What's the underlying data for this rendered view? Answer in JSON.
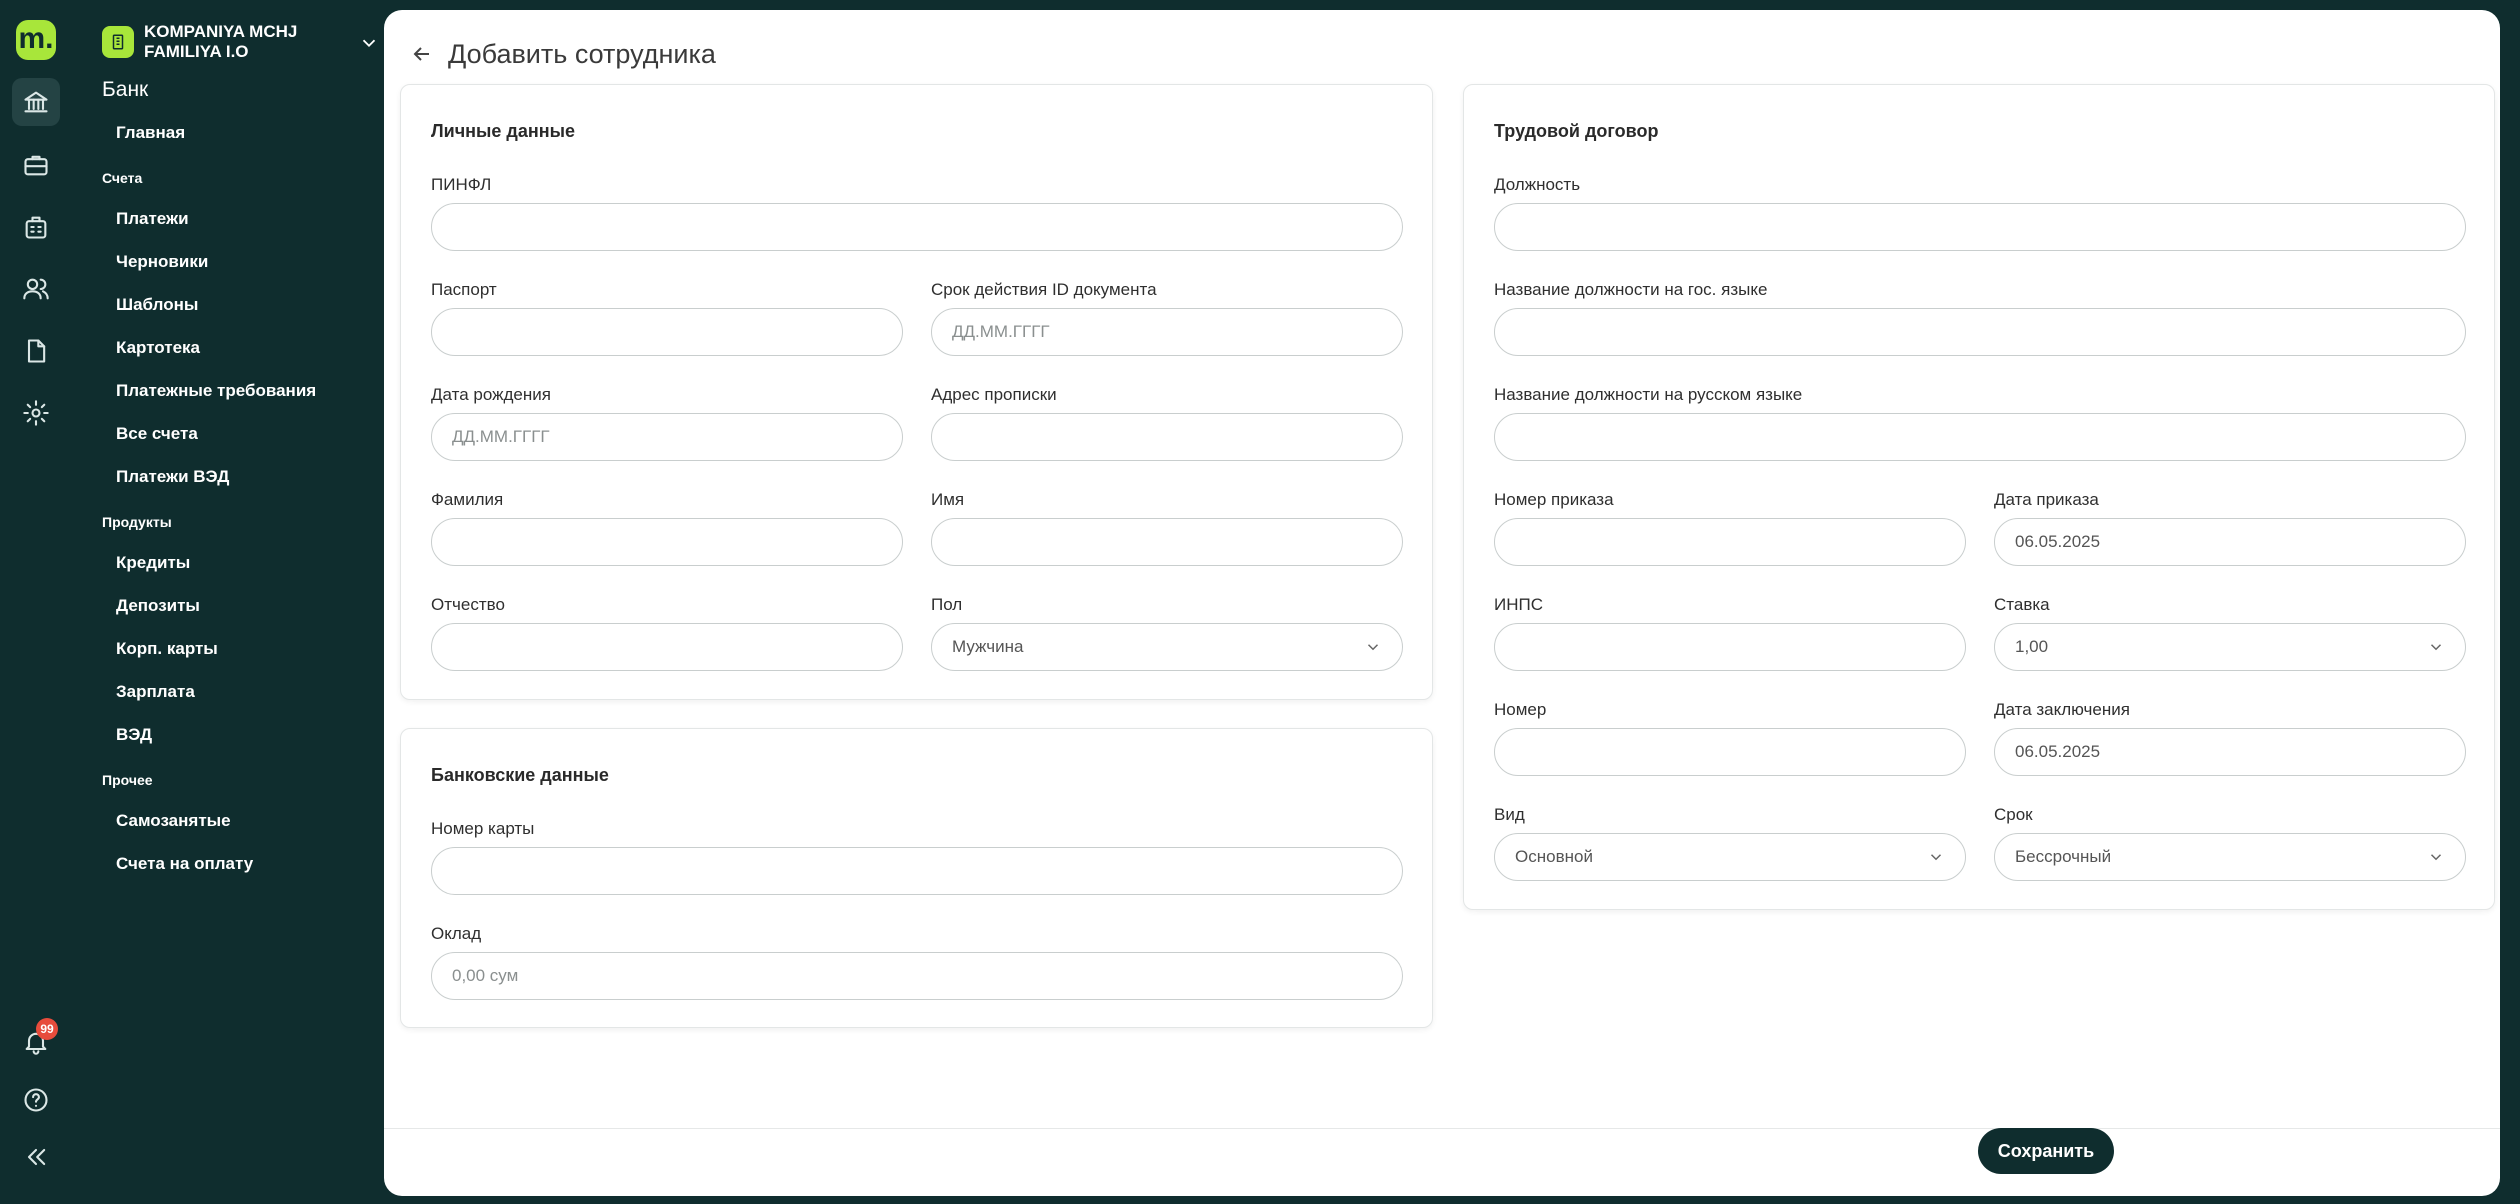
{
  "brand": {
    "logo_text": "m.",
    "accent": "#a8e63a",
    "dark": "#0f2d2e"
  },
  "rail": {
    "icons": [
      "bank-icon",
      "briefcase-icon",
      "calculator-bag-icon",
      "users-icon",
      "document-icon",
      "gear-icon"
    ],
    "notifications_count": "99"
  },
  "company": {
    "name": "KOMPANIYA MCHJ FAMILIYA I.O"
  },
  "menu": {
    "title": "Банк",
    "home": "Главная",
    "accounts_section": "Счета",
    "accounts": [
      "Платежи",
      "Черновики",
      "Шаблоны",
      "Картотека",
      "Платежные требования",
      "Все счета",
      "Платежи ВЭД"
    ],
    "products_section": "Продукты",
    "products": [
      "Кредиты",
      "Депозиты",
      "Корп. карты",
      "Зарплата",
      "ВЭД"
    ],
    "other_section": "Прочее",
    "other": [
      "Самозанятые",
      "Счета на оплату"
    ]
  },
  "page": {
    "title": "Добавить сотрудника"
  },
  "personal": {
    "title": "Личные данные",
    "pinfl_label": "ПИНФЛ",
    "passport_label": "Паспорт",
    "doc_expiry_label": "Срок действия ID документа",
    "doc_expiry_placeholder": "ДД.ММ.ГГГГ",
    "birth_label": "Дата рождения",
    "birth_placeholder": "ДД.ММ.ГГГГ",
    "address_label": "Адрес прописки",
    "surname_label": "Фамилия",
    "name_label": "Имя",
    "patronymic_label": "Отчество",
    "gender_label": "Пол",
    "gender_value": "Мужчина"
  },
  "bank": {
    "title": "Банковские данные",
    "card_label": "Номер карты",
    "salary_label": "Оклад",
    "salary_placeholder": "0,00 сум"
  },
  "contract": {
    "title": "Трудовой договор",
    "position_label": "Должность",
    "position_state_label": "Название должности на гос. языке",
    "position_ru_label": "Название должности на русском языке",
    "order_number_label": "Номер приказа",
    "order_date_label": "Дата приказа",
    "order_date_value": "06.05.2025",
    "inps_label": "ИНПС",
    "rate_label": "Ставка",
    "rate_value": "1,00",
    "number_label": "Номер",
    "conclusion_date_label": "Дата заключения",
    "conclusion_date_value": "06.05.2025",
    "type_label": "Вид",
    "type_value": "Основной",
    "term_label": "Срок",
    "term_value": "Бессрочный"
  },
  "footer": {
    "save_label": "Сохранить"
  }
}
